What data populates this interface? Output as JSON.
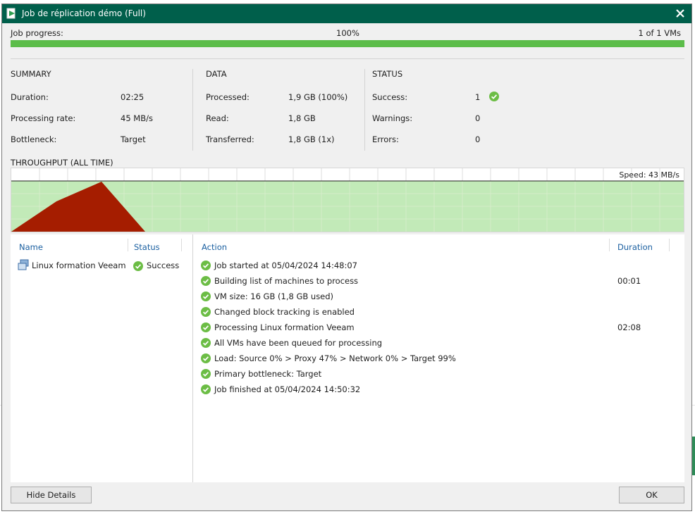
{
  "window": {
    "title": "Job de réplication démo (Full)"
  },
  "progress": {
    "label": "Job progress:",
    "percent_text": "100%",
    "vms": "1 of 1 VMs",
    "fraction": 1.0
  },
  "summary": {
    "title": "SUMMARY",
    "rows": [
      {
        "label": "Duration:",
        "value": "02:25"
      },
      {
        "label": "Processing rate:",
        "value": "45 MB/s"
      },
      {
        "label": "Bottleneck:",
        "value": "Target"
      }
    ]
  },
  "data": {
    "title": "DATA",
    "rows": [
      {
        "label": "Processed:",
        "value": "1,9 GB (100%)"
      },
      {
        "label": "Read:",
        "value": "1,8 GB"
      },
      {
        "label": "Transferred:",
        "value": "1,8 GB (1x)"
      }
    ]
  },
  "status": {
    "title": "STATUS",
    "rows": [
      {
        "label": "Success:",
        "value": "1"
      },
      {
        "label": "Warnings:",
        "value": "0"
      },
      {
        "label": "Errors:",
        "value": "0"
      }
    ]
  },
  "throughput": {
    "title": "THROUGHPUT (ALL TIME)",
    "speed": "Speed: 43 MB/s"
  },
  "vm_list": {
    "headers": {
      "name": "Name",
      "status": "Status"
    },
    "items": [
      {
        "name": "Linux formation Veeam",
        "status": "Success"
      }
    ]
  },
  "actions": {
    "headers": {
      "action": "Action",
      "duration": "Duration"
    },
    "items": [
      {
        "text": "Job started at 05/04/2024 14:48:07",
        "duration": ""
      },
      {
        "text": "Building list of machines to process",
        "duration": "00:01"
      },
      {
        "text": "VM size: 16 GB (1,8 GB used)",
        "duration": ""
      },
      {
        "text": "Changed block tracking is enabled",
        "duration": ""
      },
      {
        "text": "Processing Linux formation Veeam",
        "duration": "02:08"
      },
      {
        "text": "All VMs have been queued for processing",
        "duration": ""
      },
      {
        "text": "Load: Source 0% > Proxy 47% > Network 0% > Target 99%",
        "duration": ""
      },
      {
        "text": "Primary bottleneck: Target",
        "duration": ""
      },
      {
        "text": "Job finished at 05/04/2024 14:50:32",
        "duration": ""
      }
    ]
  },
  "buttons": {
    "hide_details": "Hide Details",
    "ok": "OK"
  },
  "colors": {
    "title_bar": "#005f4b",
    "progress": "#5cbd4a",
    "success": "#6cbd45",
    "throughput_fill": "#c2eab8",
    "bottleneck_area": "#a51d00",
    "link": "#1a5fa0"
  }
}
